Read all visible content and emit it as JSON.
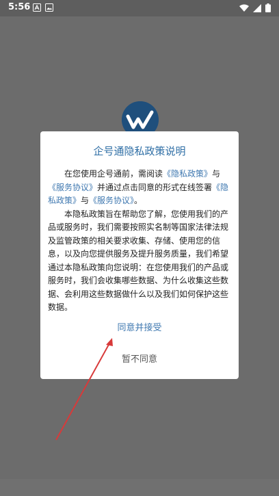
{
  "status_bar": {
    "time": "5:56",
    "left_icons": [
      "font-icon",
      "gallery-icon"
    ],
    "right_icons": [
      "wifi-icon",
      "signal-icon",
      "battery-icon"
    ]
  },
  "background": {
    "logo_icon": "app-logo-icon"
  },
  "dialog": {
    "title": "企号通隐私政策说明",
    "p1": {
      "t1": "在您使用企号通前，需阅读",
      "link1": "《隐私政策》",
      "t2": "与",
      "link2": "《服务协议》",
      "t3": "并通过点击同意的形式在线签署",
      "link3": "《隐私政策》",
      "t4": "与",
      "link4": "《服务协议》",
      "t5": "。"
    },
    "p2": "本隐私政策旨在帮助您了解，您使用我们的产品或服务时，我们需要按照实名制等国家法律法规及监管政策的相关要求收集、存储、使用您的信息，以及向您提供服务及提升服务质量，我们希望通过本隐私政策向您说明：在您使用我们的产品或服务时，我们会收集哪些数据、为什么收集这些数据、会利用这些数据做什么以及我们如何保护这些数据。",
    "accept_label": "同意并接受",
    "decline_label": "暂不同意"
  },
  "colors": {
    "accent": "#3f78b0",
    "title": "#2e6ea5",
    "overlay": "#6c6c6c",
    "annotation_arrow": "#d83a3a"
  }
}
